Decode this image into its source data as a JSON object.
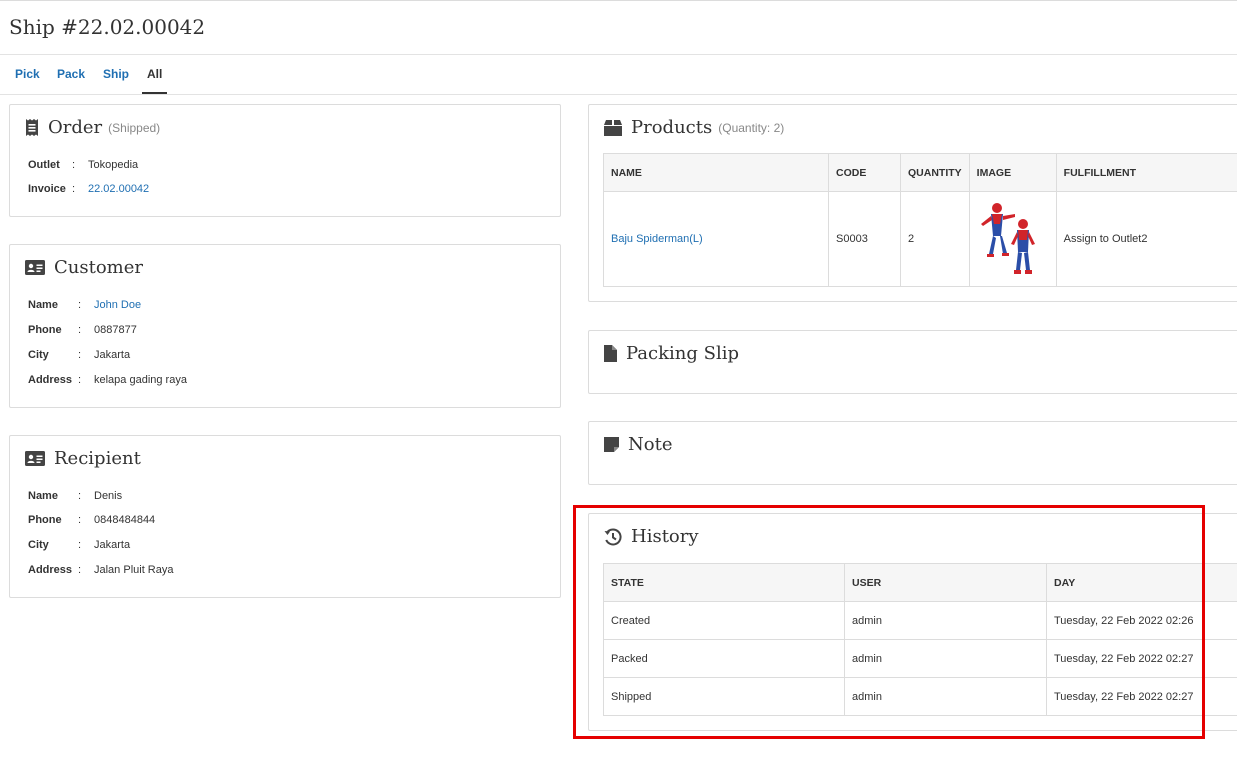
{
  "page": {
    "title": "Ship #22.02.00042"
  },
  "tabs": [
    {
      "label": "Pick"
    },
    {
      "label": "Pack"
    },
    {
      "label": "Ship"
    },
    {
      "label": "All"
    }
  ],
  "order": {
    "title": "Order",
    "status": "(Shipped)",
    "fields": [
      {
        "label": "Outlet",
        "value": "Tokopedia"
      },
      {
        "label": "Invoice",
        "value": "22.02.00042"
      }
    ]
  },
  "customer": {
    "title": "Customer",
    "fields": [
      {
        "label": "Name",
        "value": "John Doe"
      },
      {
        "label": "Phone",
        "value": "0887877"
      },
      {
        "label": "City",
        "value": "Jakarta"
      },
      {
        "label": "Address",
        "value": "kelapa gading raya"
      }
    ]
  },
  "recipient": {
    "title": "Recipient",
    "fields": [
      {
        "label": "Name",
        "value": "Denis"
      },
      {
        "label": "Phone",
        "value": "0848484844"
      },
      {
        "label": "City",
        "value": "Jakarta"
      },
      {
        "label": "Address",
        "value": "Jalan Pluit Raya"
      }
    ]
  },
  "products": {
    "title": "Products",
    "quantity": "(Quantity: 2)",
    "columns": [
      "NAME",
      "CODE",
      "QUANTITY",
      "IMAGE",
      "FULFILLMENT"
    ],
    "rows": [
      {
        "name": "Baju Spiderman(L)",
        "code": "S0003",
        "quantity": "2",
        "fulfillment": "Assign to Outlet2"
      }
    ]
  },
  "packing_slip": {
    "title": "Packing Slip"
  },
  "note": {
    "title": "Note"
  },
  "history": {
    "title": "History",
    "columns": [
      "STATE",
      "USER",
      "DAY"
    ],
    "rows": [
      {
        "state": "Created",
        "user": "admin",
        "day": "Tuesday, 22 Feb 2022 02:26"
      },
      {
        "state": "Packed",
        "user": "admin",
        "day": "Tuesday, 22 Feb 2022 02:27"
      },
      {
        "state": "Shipped",
        "user": "admin",
        "day": "Tuesday, 22 Feb 2022 02:27"
      }
    ]
  },
  "icons": {
    "order": "receipt-icon",
    "customer": "id-card-icon",
    "recipient": "id-card-icon",
    "products": "box-icon",
    "packing_slip": "file-icon",
    "note": "sticky-note-icon",
    "history": "history-icon"
  },
  "colors": {
    "link": "#1f6fb2",
    "highlight": "#e50000"
  }
}
